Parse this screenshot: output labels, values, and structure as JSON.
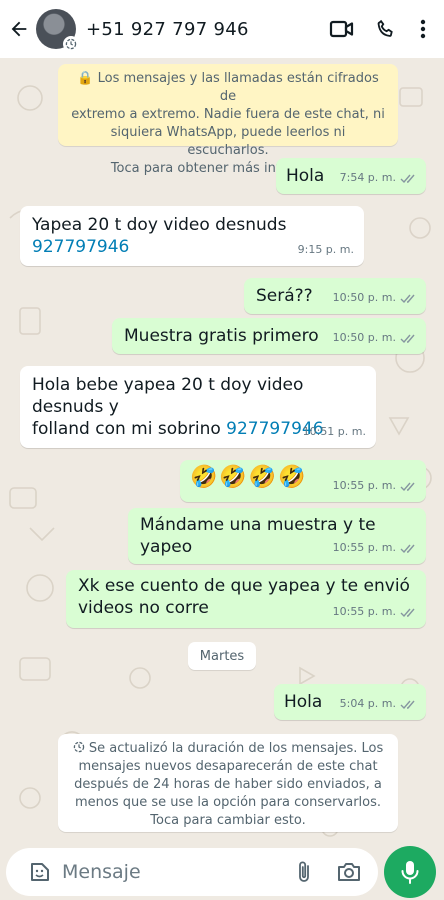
{
  "header": {
    "contact_name": "+51 927 797 946"
  },
  "encryption_notice": {
    "lines": [
      "🔒 Los mensajes y las llamadas están cifrados de",
      "extremo a extremo. Nadie fuera de este chat, ni",
      "siquiera WhatsApp, puede leerlos ni escucharlos.",
      "Toca para obtener más información."
    ]
  },
  "messages": [
    {
      "dir": "out",
      "text": "Hola",
      "time": "7:54 p. m."
    },
    {
      "dir": "in",
      "text": "Yapea 20 t doy video desnuds ",
      "link": "927797946",
      "time": "9:15 p. m."
    },
    {
      "dir": "out",
      "text": "Será??",
      "time": "10:50 p. m."
    },
    {
      "dir": "out",
      "text": "Muestra gratis primero",
      "time": "10:50 p. m."
    },
    {
      "dir": "in",
      "line1": "Hola bebe yapea 20 t doy video desnuds y",
      "line2": "folland con mi sobrino ",
      "link": "927797946",
      "time": "10:51 p. m."
    },
    {
      "dir": "out",
      "text": "🤣🤣🤣🤣",
      "time": "10:55 p. m."
    },
    {
      "dir": "out",
      "text": "Mándame una muestra y te yapeo",
      "time": "10:55 p. m."
    },
    {
      "dir": "out",
      "line1": "Xk ese cuento de que yapea y te envió",
      "line2": "videos no corre",
      "time": "10:55 p. m."
    },
    {
      "dir": "out",
      "text": "Hola",
      "time": "5:04 p. m."
    }
  ],
  "day_separator": "Martes",
  "disappearing_notice": {
    "lines": [
      "Se actualizó la duración de los mensajes. Los",
      "mensajes nuevos desaparecerán de este chat",
      "después de 24 horas de haber sido enviados, a",
      "menos que se use la opción para conservarlos.",
      "Toca para cambiar esto."
    ]
  },
  "composer": {
    "placeholder": "Mensaje"
  },
  "colors": {
    "outgoing": "#d9fdd3",
    "incoming": "#ffffff",
    "accent": "#1daa61",
    "link": "#027eb5",
    "ticks": "#8696a0"
  },
  "icons": [
    "back-arrow-icon",
    "disappearing-timer-icon",
    "video-call-icon",
    "phone-icon",
    "more-icon",
    "sticker-icon",
    "attach-icon",
    "camera-icon",
    "mic-icon"
  ]
}
